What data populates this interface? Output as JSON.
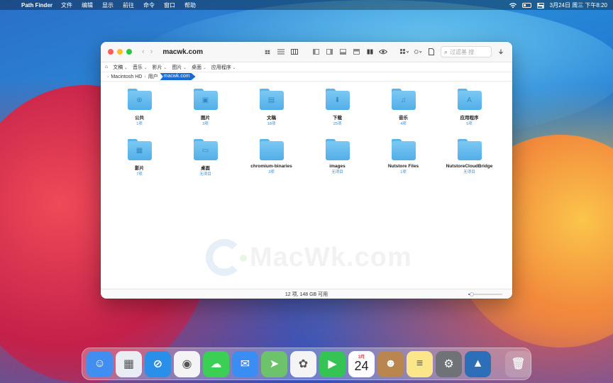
{
  "menubar": {
    "app_name": "Path Finder",
    "menus": [
      "文件",
      "编辑",
      "显示",
      "前往",
      "命令",
      "窗口",
      "帮助"
    ],
    "clock": "3月24日 周三 下午8:20"
  },
  "window": {
    "title": "macwk.com",
    "search_placeholder": "过滤基 搜",
    "favorites": [
      "文稿",
      "音乐",
      "影片",
      "图片",
      "桌面",
      "应用程序"
    ],
    "path": {
      "crumbs": [
        "Macintosh HD",
        "用户"
      ],
      "current": "macwk.com"
    },
    "items": [
      {
        "name": "公共",
        "count": "1项",
        "glyph": "⊕",
        "icon": "public-folder-icon"
      },
      {
        "name": "图片",
        "count": "3项",
        "glyph": "▣",
        "icon": "pictures-folder-icon"
      },
      {
        "name": "文稿",
        "count": "18项",
        "glyph": "▤",
        "icon": "documents-folder-icon"
      },
      {
        "name": "下载",
        "count": "25项",
        "glyph": "⬇",
        "icon": "downloads-folder-icon"
      },
      {
        "name": "音乐",
        "count": "4项",
        "glyph": "♫",
        "icon": "music-folder-icon"
      },
      {
        "name": "应用程序",
        "count": "5项",
        "glyph": "A",
        "icon": "applications-folder-icon"
      },
      {
        "name": "影片",
        "count": "7项",
        "glyph": "▦",
        "icon": "movies-folder-icon"
      },
      {
        "name": "桌面",
        "count": "无项目",
        "glyph": "▭",
        "icon": "desktop-folder-icon"
      },
      {
        "name": "chromium-binaries",
        "count": "3项",
        "glyph": "",
        "icon": "folder-icon"
      },
      {
        "name": "images",
        "count": "无项目",
        "glyph": "",
        "icon": "folder-icon"
      },
      {
        "name": "Nutstore Files",
        "count": "1项",
        "glyph": "",
        "icon": "folder-icon"
      },
      {
        "name": "NutstoreCloudBridge",
        "count": "无项目",
        "glyph": "",
        "icon": "folder-icon"
      }
    ],
    "status": "12 项, 148 GB 可用",
    "watermark": "MacWk.com",
    "zoom_level": 0.1
  },
  "dock": {
    "apps": [
      {
        "name": "finder",
        "color": "#3f8ef0",
        "glyph": "☺"
      },
      {
        "name": "launchpad",
        "color": "#e9eef5",
        "glyph": "▦"
      },
      {
        "name": "safari",
        "color": "#2a8fe8",
        "glyph": "⊘"
      },
      {
        "name": "chrome",
        "color": "#f4f4f4",
        "glyph": "◉"
      },
      {
        "name": "messages",
        "color": "#3bcf55",
        "glyph": "☁"
      },
      {
        "name": "mail",
        "color": "#3a8ef3",
        "glyph": "✉"
      },
      {
        "name": "maps",
        "color": "#6cc36b",
        "glyph": "➤"
      },
      {
        "name": "photos",
        "color": "#f4f4f4",
        "glyph": "✿"
      },
      {
        "name": "facetime",
        "color": "#35c353",
        "glyph": "▶"
      },
      {
        "name": "calendar",
        "color": "#ffffff",
        "glyph": ""
      },
      {
        "name": "contacts",
        "color": "#b8864e",
        "glyph": "☻"
      },
      {
        "name": "notes",
        "color": "#fbe78a",
        "glyph": "≡"
      },
      {
        "name": "system-preferences",
        "color": "#6f7378",
        "glyph": "⚙"
      },
      {
        "name": "path-finder",
        "color": "#2c6fb8",
        "glyph": "▲"
      }
    ],
    "calendar_month": "3月",
    "calendar_day": "24",
    "trash_glyph": "🗑"
  }
}
